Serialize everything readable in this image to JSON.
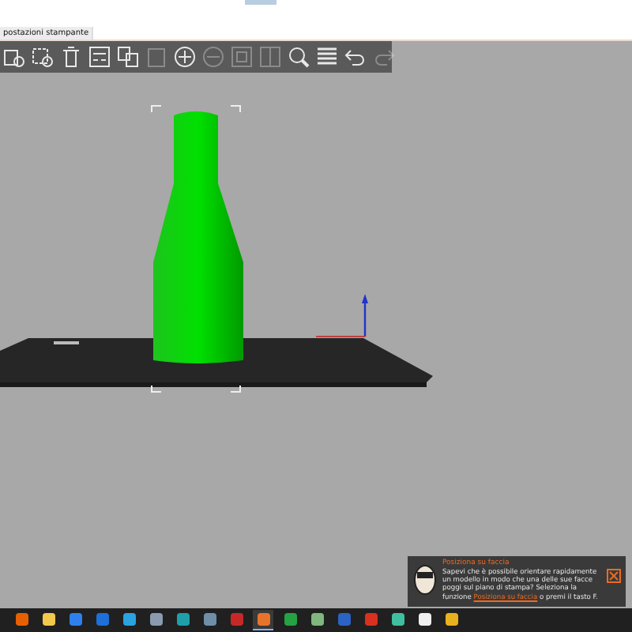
{
  "tab": {
    "label": "postazioni stampante",
    "selected": true
  },
  "toolbar": [
    {
      "kind": "add",
      "disabled": false
    },
    {
      "kind": "delete",
      "disabled": false
    },
    {
      "kind": "delete_all",
      "disabled": false
    },
    {
      "kind": "arrange",
      "disabled": false
    },
    {
      "kind": "copy",
      "disabled": false
    },
    {
      "kind": "paste",
      "disabled": true
    },
    {
      "kind": "add_instance",
      "disabled": false
    },
    {
      "kind": "remove_instance",
      "disabled": true
    },
    {
      "kind": "split_objects",
      "disabled": true
    },
    {
      "kind": "split_parts",
      "disabled": true
    },
    {
      "kind": "search",
      "disabled": false
    },
    {
      "kind": "layers",
      "disabled": false
    },
    {
      "kind": "undo",
      "disabled": false
    },
    {
      "kind": "redo",
      "disabled": true
    }
  ],
  "notification": {
    "title": "Posiziona su faccia",
    "text_before": "Sapevi che è possibile orientare rapidamente un modello in modo che una delle sue facce poggi sul piano di stampa? Seleziona la funzione ",
    "link": "Posiziona su faccia",
    "text_after": " o premi il tasto F."
  },
  "taskbar": [
    {
      "color": "#e66000",
      "selected": false
    },
    {
      "color": "#f2c94c",
      "selected": false
    },
    {
      "color": "#2f80ed",
      "selected": false
    },
    {
      "color": "#1e6fd9",
      "selected": false
    },
    {
      "color": "#2aa3e0",
      "selected": false
    },
    {
      "color": "#8a9bb0",
      "selected": false
    },
    {
      "color": "#1fa0a8",
      "selected": false
    },
    {
      "color": "#6f8fa8",
      "selected": false
    },
    {
      "color": "#c62828",
      "selected": false
    },
    {
      "color": "#e8742c",
      "selected": true
    },
    {
      "color": "#25a244",
      "selected": false
    },
    {
      "color": "#7fb77e",
      "selected": false
    },
    {
      "color": "#2b63c4",
      "selected": false
    },
    {
      "color": "#d9301f",
      "selected": false
    },
    {
      "color": "#3fbf9f",
      "selected": false
    },
    {
      "color": "#eeeeee",
      "selected": false
    },
    {
      "color": "#e8b21f",
      "selected": false
    }
  ]
}
